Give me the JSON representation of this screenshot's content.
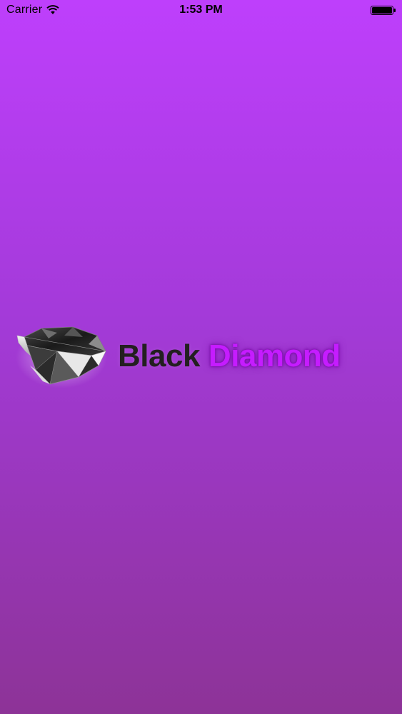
{
  "status_bar": {
    "carrier": "Carrier",
    "time": "1:53 PM",
    "icons": {
      "wifi": "wifi-icon",
      "battery": "battery-icon"
    }
  },
  "splash": {
    "logo_icon": "diamond-icon",
    "brand_word_1": "Black",
    "brand_word_2": "Diamond"
  },
  "colors": {
    "background_top": "#be3ffc",
    "background_bottom": "#8d3397",
    "brand_dark": "#231f20",
    "brand_purple": "#c51cff"
  }
}
